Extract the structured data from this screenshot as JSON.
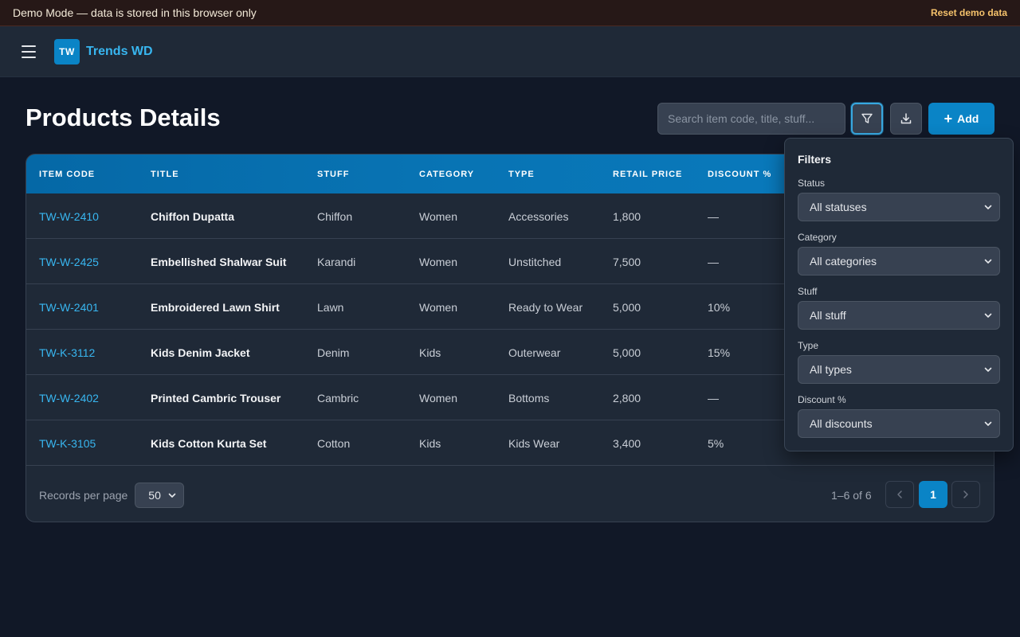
{
  "banner": {
    "message": "Demo Mode — data is stored in this browser only",
    "reset_label": "Reset demo data"
  },
  "header": {
    "logo_text": "TW",
    "brand": "Trends WD"
  },
  "page": {
    "title": "Products Details"
  },
  "toolbar": {
    "search_placeholder": "Search item code, title, stuff...",
    "add_label": "Add"
  },
  "table": {
    "columns": [
      "ITEM CODE",
      "TITLE",
      "STUFF",
      "CATEGORY",
      "TYPE",
      "RETAIL PRICE",
      "DISCOUNT %"
    ],
    "rows": [
      {
        "code": "TW-W-2410",
        "title": "Chiffon Dupatta",
        "stuff": "Chiffon",
        "category": "Women",
        "type": "Accessories",
        "price": "1,800",
        "discount": "—"
      },
      {
        "code": "TW-W-2425",
        "title": "Embellished Shalwar Suit",
        "stuff": "Karandi",
        "category": "Women",
        "type": "Unstitched",
        "price": "7,500",
        "discount": "—"
      },
      {
        "code": "TW-W-2401",
        "title": "Embroidered Lawn Shirt",
        "stuff": "Lawn",
        "category": "Women",
        "type": "Ready to Wear",
        "price": "5,000",
        "discount": "10%"
      },
      {
        "code": "TW-K-3112",
        "title": "Kids Denim Jacket",
        "stuff": "Denim",
        "category": "Kids",
        "type": "Outerwear",
        "price": "5,000",
        "discount": "15%"
      },
      {
        "code": "TW-W-2402",
        "title": "Printed Cambric Trouser",
        "stuff": "Cambric",
        "category": "Women",
        "type": "Bottoms",
        "price": "2,800",
        "discount": "—"
      },
      {
        "code": "TW-K-3105",
        "title": "Kids Cotton Kurta Set",
        "stuff": "Cotton",
        "category": "Kids",
        "type": "Kids Wear",
        "price": "3,400",
        "discount": "5%"
      }
    ]
  },
  "footer": {
    "records_label": "Records per page",
    "records_value": "50",
    "range_text": "1–6 of 6",
    "current_page": "1"
  },
  "filters": {
    "title": "Filters",
    "status": {
      "label": "Status",
      "value": "All statuses"
    },
    "category": {
      "label": "Category",
      "value": "All categories"
    },
    "stuff": {
      "label": "Stuff",
      "value": "All stuff"
    },
    "type": {
      "label": "Type",
      "value": "All types"
    },
    "discount": {
      "label": "Discount %",
      "value": "All discounts"
    }
  },
  "icons": [
    "hamburger-icon",
    "filter-icon",
    "download-icon",
    "plus-icon",
    "chevron-left-icon",
    "chevron-right-icon",
    "chevron-down-icon"
  ]
}
